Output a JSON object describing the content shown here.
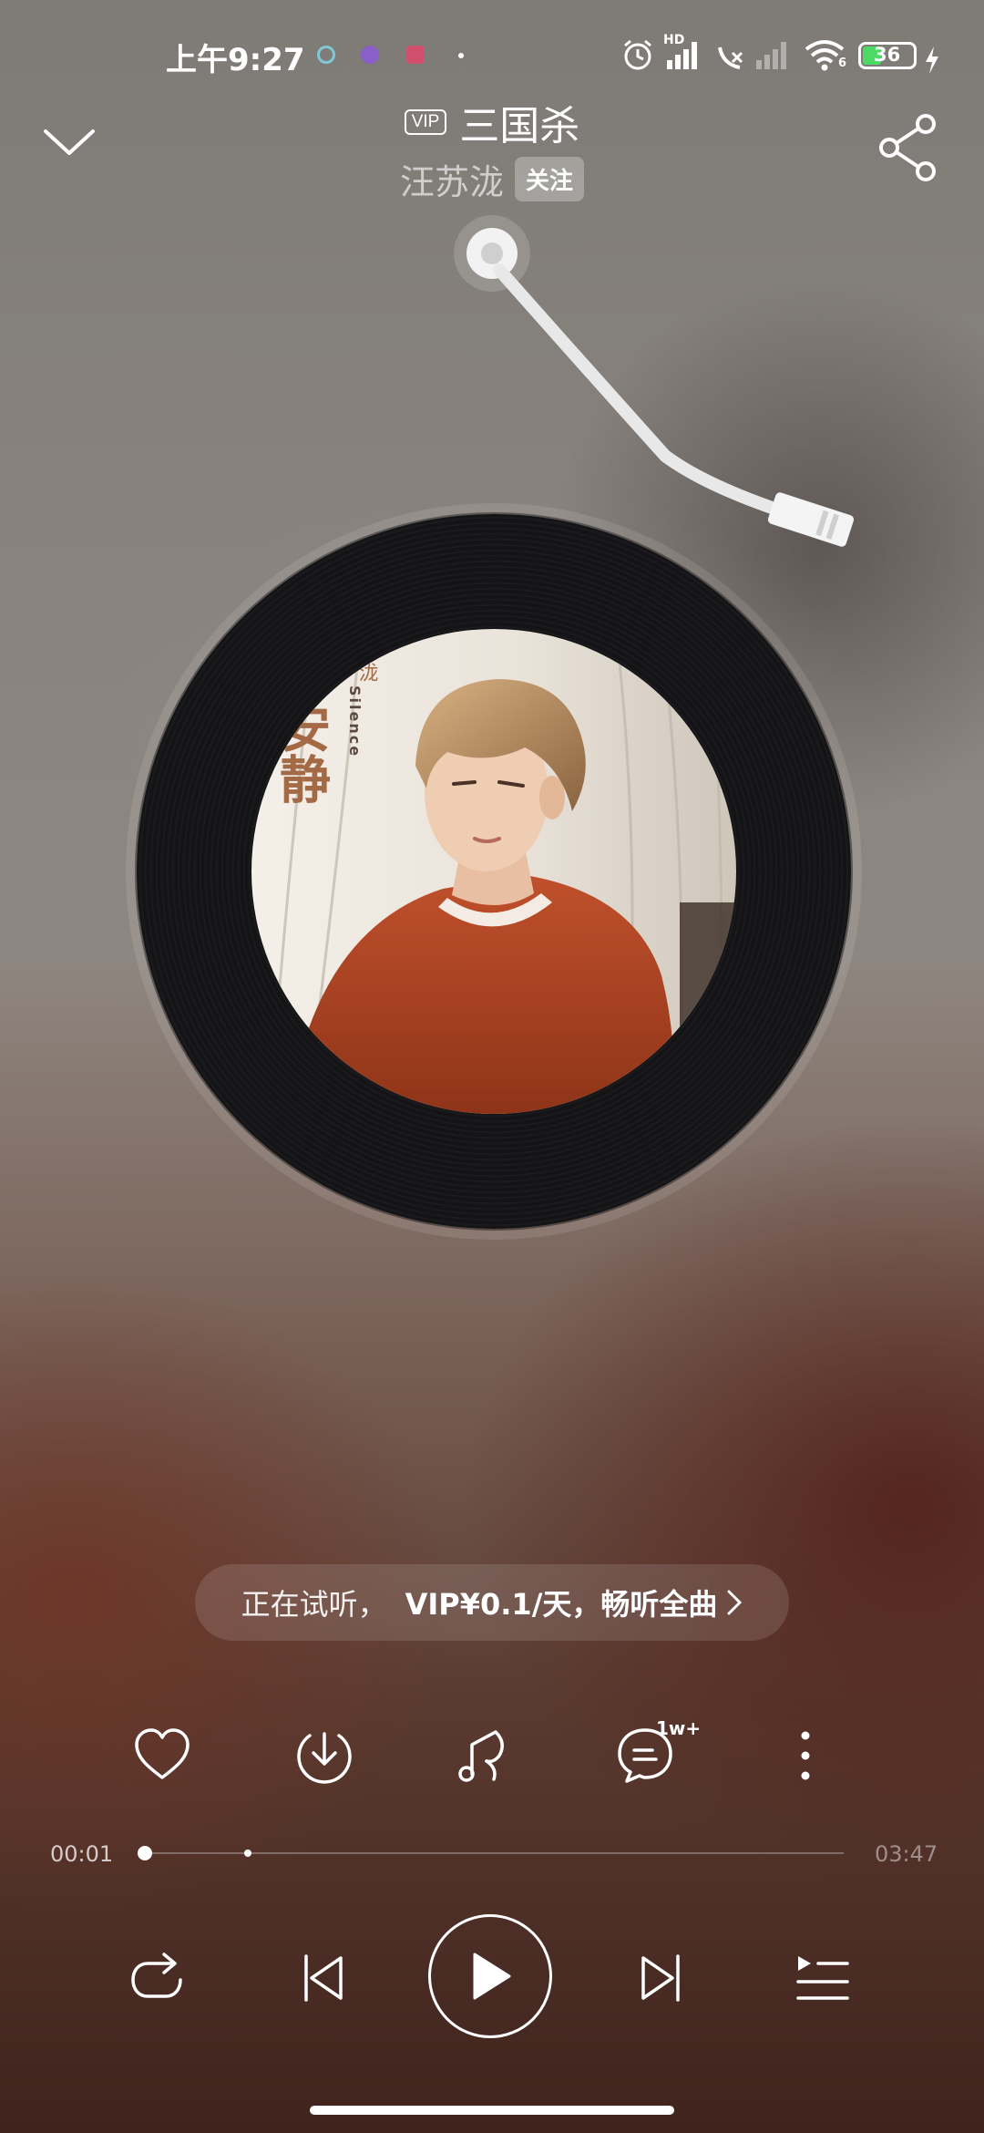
{
  "status_bar": {
    "time": "上午9:27",
    "battery_level": "36",
    "network_label": "HD",
    "wifi_label": "6"
  },
  "header": {
    "vip_tag": "VIP",
    "song_title": "三国杀",
    "artist": "汪苏泷",
    "follow_label": "关注"
  },
  "album_art": {
    "cover_text_vertical": "安静",
    "cover_text_small": "苏泷",
    "cover_text_latin": "Silence"
  },
  "trial_banner": {
    "text": "正在试听，",
    "offer": "VIP¥0.1/天，畅听全曲"
  },
  "actions": {
    "comment_count": "1w+"
  },
  "playback": {
    "current_time": "00:01",
    "total_time": "03:47",
    "progress_fraction": 0.004,
    "buffered_fraction": 0.15
  },
  "colors": {
    "record": "#141416",
    "accent": "#ffffff",
    "battery_fill": "#4cd964"
  },
  "icons": {
    "collapse": "chevron-down-icon",
    "share": "share-icon",
    "like": "heart-icon",
    "download": "download-icon",
    "effects": "music-note-icon",
    "comments": "comment-icon",
    "more": "more-vertical-icon",
    "repeat": "repeat-icon",
    "previous": "previous-icon",
    "play": "play-icon",
    "next": "next-icon",
    "playlist": "playlist-icon"
  }
}
